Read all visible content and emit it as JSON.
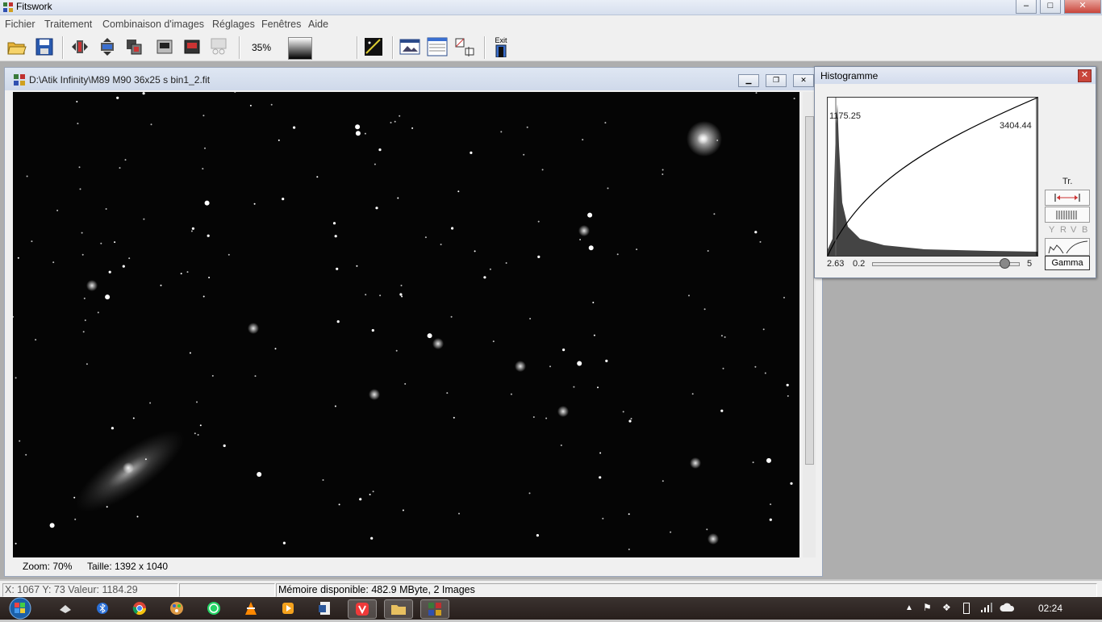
{
  "window": {
    "title": "Fitswork",
    "min": "–",
    "max": "□",
    "close": "✕"
  },
  "menu": [
    "Fichier",
    "Traitement",
    "Combinaison d'images",
    "Réglages",
    "Fenêtres",
    "Aide"
  ],
  "toolbar": {
    "zoom_label": "35%",
    "exit_label": "Exit"
  },
  "image_window": {
    "path": "D:\\Atik Infinity\\M89 M90 36x25 s bin1_2.fit",
    "zoom": "Zoom: 70%",
    "size": "Taille: 1392 x 1040"
  },
  "histogram": {
    "title": "Histogramme",
    "low_value": "1175.25",
    "high_value": "3404.44",
    "gamma_value": "2.63",
    "slider_min": "0.2",
    "slider_max": "5",
    "slider_position": 0.9,
    "tr_label": "Tr.",
    "channels": [
      "Y",
      "R",
      "V",
      "B"
    ],
    "gamma_button": "Gamma"
  },
  "status": {
    "coords": "X: 1067  Y: 73  Valeur: 1184.29",
    "middle": "",
    "memory": "Mémoire disponible: 482.9 MByte, 2 Images"
  },
  "taskbar": {
    "clock": "02:24",
    "apps": [
      "file-transfer-icon",
      "bluetooth-icon",
      "chrome-icon",
      "paint-icon",
      "whatsapp-icon",
      "vlc-icon",
      "media-player-icon",
      "word-icon",
      "vivaldi-icon",
      "explorer-icon",
      "fitswork-icon"
    ]
  },
  "colors": {
    "titlebar": "#d6dfee",
    "canvas": "#050505",
    "taskbar": "#281f1c"
  }
}
